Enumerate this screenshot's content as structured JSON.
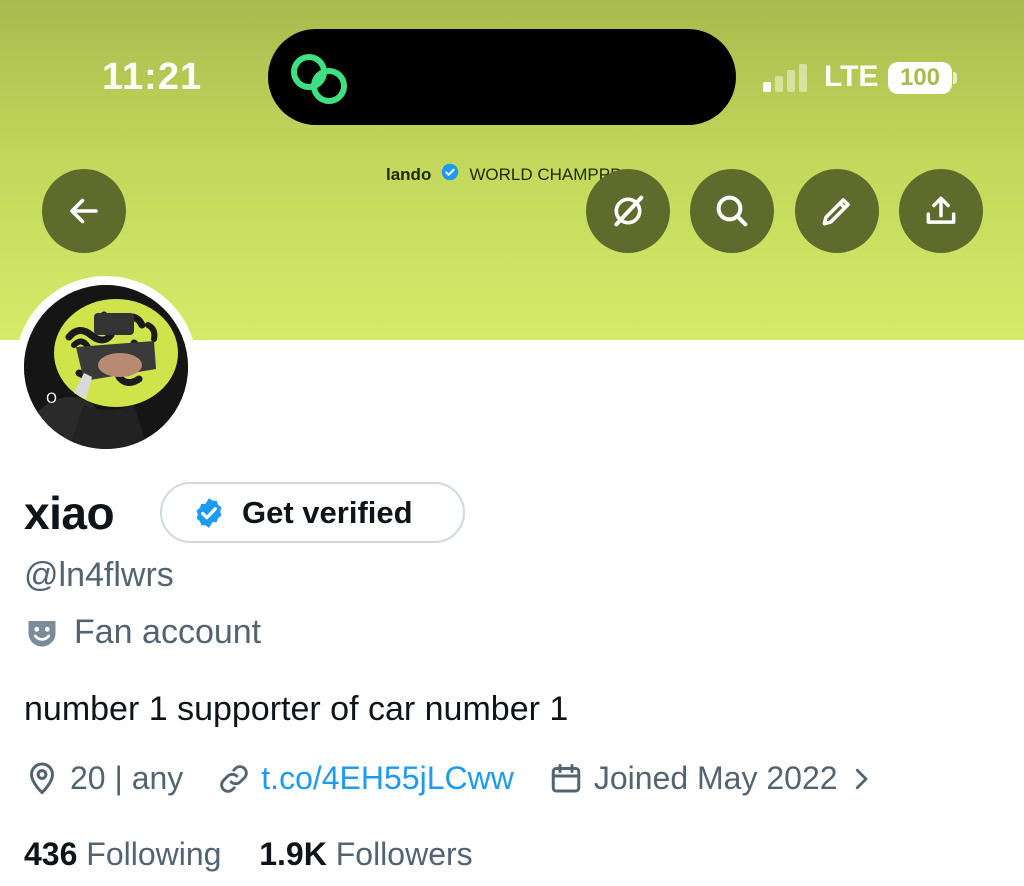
{
  "status_bar": {
    "time": "11:21",
    "network": "LTE",
    "battery": "100"
  },
  "header": {
    "name": "lando",
    "status": "WORLD CHAMPPP"
  },
  "profile": {
    "display_name": "xiao",
    "get_verified_label": "Get verified",
    "handle": "@ln4flwrs",
    "category": "Fan account",
    "bio": "number 1 supporter of car number 1",
    "location": "20 | any",
    "link": "t.co/4EH55jLCww",
    "joined": "Joined May 2022",
    "following_count": "436",
    "following_label": "Following",
    "followers_count": "1.9K",
    "followers_label": "Followers"
  },
  "icons": {
    "back": "arrow-left-icon",
    "grok": "grok-icon",
    "search": "search-icon",
    "edit": "pencil-icon",
    "share": "share-icon"
  },
  "colors": {
    "banner_top": "#a9ba4f",
    "banner_bottom": "#d6ea6a",
    "nav_button": "#5f6b2c",
    "link": "#1d9bf0",
    "verified": "#1d9bf0",
    "secondary_text": "#536471"
  }
}
